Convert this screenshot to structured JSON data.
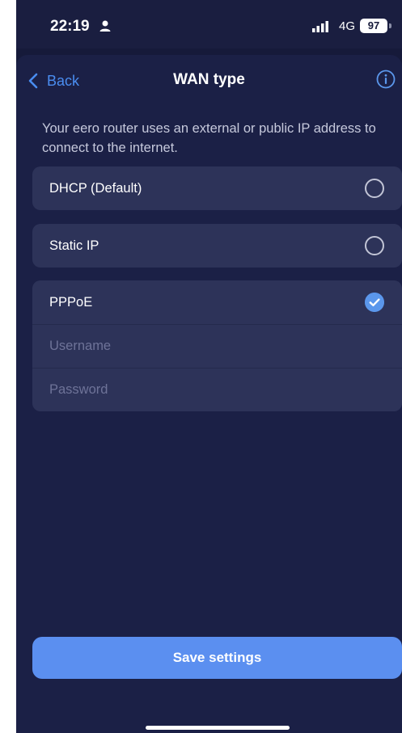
{
  "status_bar": {
    "time": "22:19",
    "network": "4G",
    "battery": "97",
    "icons": [
      "person-icon",
      "signal-icon",
      "battery-icon"
    ]
  },
  "header": {
    "back_label": "Back",
    "title": "WAN type",
    "info_icon": "info-icon"
  },
  "description": "Your eero router uses an external or public IP address to connect to the internet.",
  "options": [
    {
      "label": "DHCP (Default)",
      "selected": false
    },
    {
      "label": "Static IP",
      "selected": false
    },
    {
      "label": "PPPoE",
      "selected": true
    }
  ],
  "pppoe": {
    "username_placeholder": "Username",
    "password_placeholder": "Password",
    "username_value": "",
    "password_value": ""
  },
  "save_label": "Save settings",
  "colors": {
    "background": "#161a3a",
    "sheet": "#1b2046",
    "card": "#2d3359",
    "accent": "#5b8ff0",
    "link": "#4a8df0"
  }
}
